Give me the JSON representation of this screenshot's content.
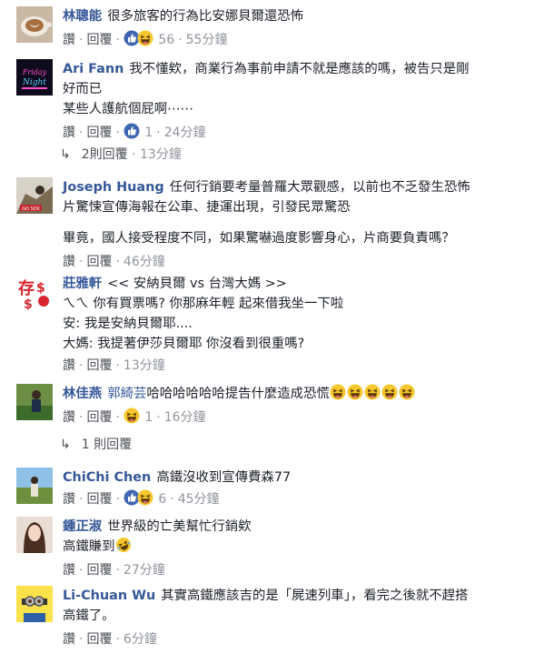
{
  "labels": {
    "like": "讚",
    "reply": "回覆"
  },
  "comments": [
    {
      "author": "林聰能",
      "lines": [
        "很多旅客的行為比安娜貝爾還恐怖"
      ],
      "reaction_count": "56",
      "time": "55分鐘"
    },
    {
      "author": "Ari Fann",
      "lines": [
        "我不懂欸，商業行為事前申請不就是應該的嗎，被告只是剛",
        "好而已",
        "某些人護航個屁啊⋯⋯"
      ],
      "reaction_count": "1",
      "time": "24分鐘",
      "replies": {
        "label": "2則回覆",
        "time": "13分鐘"
      }
    },
    {
      "author": "Joseph Huang",
      "lines": [
        "任何行銷要考量普羅大眾觀感，以前也不乏發生恐怖",
        "片驚悚宣傳海報在公車、捷運出現，引發民眾驚恐",
        "",
        "畢竟，國人接受程度不同，如果驚嚇過度影響身心，片商要負責嗎？"
      ],
      "time": "46分鐘"
    },
    {
      "author": "莊雅軒",
      "lines": [
        "<< 安納貝爾 vs 台灣大媽 >>",
        "ㄟㄟ 你有買票嗎? 你那麻年輕 起來借我坐一下啦",
        "安: 我是安納貝爾耶....",
        "大媽: 我提著伊莎貝爾耶 你沒看到很重嗎?"
      ],
      "time": "13分鐘"
    },
    {
      "author": "林佳燕",
      "mention": "郭綺芸",
      "lines": [
        "哈哈哈哈哈哈提告什麼造成恐慌"
      ],
      "reaction_count": "1",
      "time": "16分鐘",
      "replies": {
        "label": "1 則回覆"
      }
    },
    {
      "author": "ChiChi Chen",
      "lines": [
        "高鐵沒收到宣傳費森77"
      ],
      "reaction_count": "6",
      "time": "45分鐘"
    },
    {
      "author": "鍾正淑",
      "lines": [
        "世界級的亡美幫忙行銷欸",
        "高鐵賺到"
      ],
      "time": "27分鐘"
    },
    {
      "author": "Li-Chuan Wu",
      "lines": [
        "其實高鐵應該吉的是「屍速列車」，看完之後就不趕搭",
        "高鐵了。"
      ],
      "time": "6分鐘"
    }
  ],
  "icons": {
    "like": "thumbs-up-icon",
    "haha": "laughing-face-icon",
    "rofl": "rolling-laughing-icon",
    "reply_arrow": "reply-arrow-icon"
  },
  "colors": {
    "author": "#365899",
    "meta": "#90949c",
    "like_blue": "#4267b2",
    "emoji_yellow": "#f7c72e"
  }
}
